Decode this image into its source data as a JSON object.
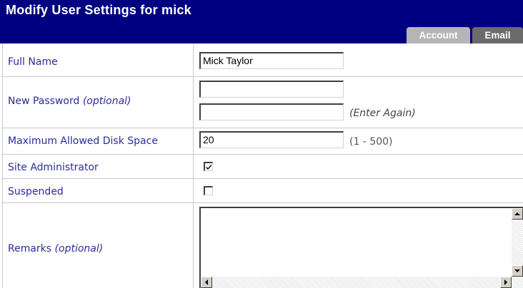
{
  "header": {
    "title": "Modify User Settings for mick",
    "tabs": [
      {
        "label": "Account",
        "active": true
      },
      {
        "label": "Email",
        "active": false
      }
    ]
  },
  "form": {
    "full_name": {
      "label": "Full Name",
      "value": "Mick Taylor"
    },
    "new_password": {
      "label": "New Password",
      "optional": "(optional)",
      "value": "",
      "confirm_value": "",
      "hint": "(Enter Again)"
    },
    "disk_space": {
      "label": "Maximum Allowed Disk Space",
      "value": "20",
      "hint": "(1 - 500)"
    },
    "site_admin": {
      "label": "Site Administrator",
      "checked": true
    },
    "suspended": {
      "label": "Suspended",
      "checked": false
    },
    "remarks": {
      "label": "Remarks",
      "optional": "(optional)",
      "value": ""
    }
  },
  "colors": {
    "header_bg": "#000080",
    "label_text": "#2b2b9b",
    "tab_active": "#b5b5b5",
    "tab_inactive": "#6b6b6b"
  }
}
